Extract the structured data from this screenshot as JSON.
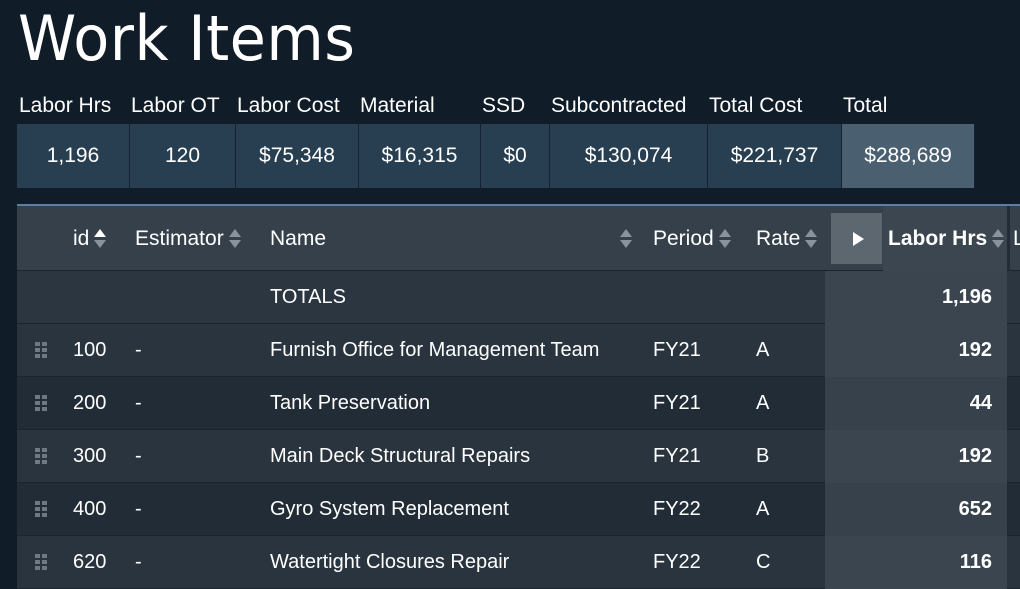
{
  "page": {
    "title": "Work Items"
  },
  "summary": {
    "labels": [
      "Labor Hrs",
      "Labor OT",
      "Labor Cost",
      "Material",
      "SSD",
      "Subcontracted",
      "Total Cost",
      "Total"
    ],
    "values": [
      "1,196",
      "120",
      "$75,348",
      "$16,315",
      "$0",
      "$130,074",
      "$221,737",
      "$288,689"
    ]
  },
  "grid": {
    "headers": {
      "id": "id",
      "estimator": "Estimator",
      "name": "Name",
      "period": "Period",
      "rate": "Rate",
      "labor_hrs": "Labor Hrs",
      "partial": "L"
    },
    "totals": {
      "label": "TOTALS",
      "labor_hrs": "1,196"
    },
    "rows": [
      {
        "id": "100",
        "estimator": "-",
        "name": "Furnish Office for Management Team",
        "period": "FY21",
        "rate": "A",
        "labor_hrs": "192"
      },
      {
        "id": "200",
        "estimator": "-",
        "name": "Tank Preservation",
        "period": "FY21",
        "rate": "A",
        "labor_hrs": "44"
      },
      {
        "id": "300",
        "estimator": "-",
        "name": "Main Deck Structural Repairs",
        "period": "FY21",
        "rate": "B",
        "labor_hrs": "192"
      },
      {
        "id": "400",
        "estimator": "-",
        "name": "Gyro System Replacement",
        "period": "FY22",
        "rate": "A",
        "labor_hrs": "652"
      },
      {
        "id": "620",
        "estimator": "-",
        "name": "Watertight Closures Repair",
        "period": "FY22",
        "rate": "C",
        "labor_hrs": "116"
      }
    ]
  },
  "colors": {
    "background": "#111c29",
    "summary_cell": "#283f52",
    "summary_total": "#4a6070",
    "grid_accent": "#5b7fa0"
  },
  "icons": {
    "sort": "sort-arrows-icon",
    "drag": "drag-handle-icon",
    "expand": "play-triangle-icon"
  }
}
